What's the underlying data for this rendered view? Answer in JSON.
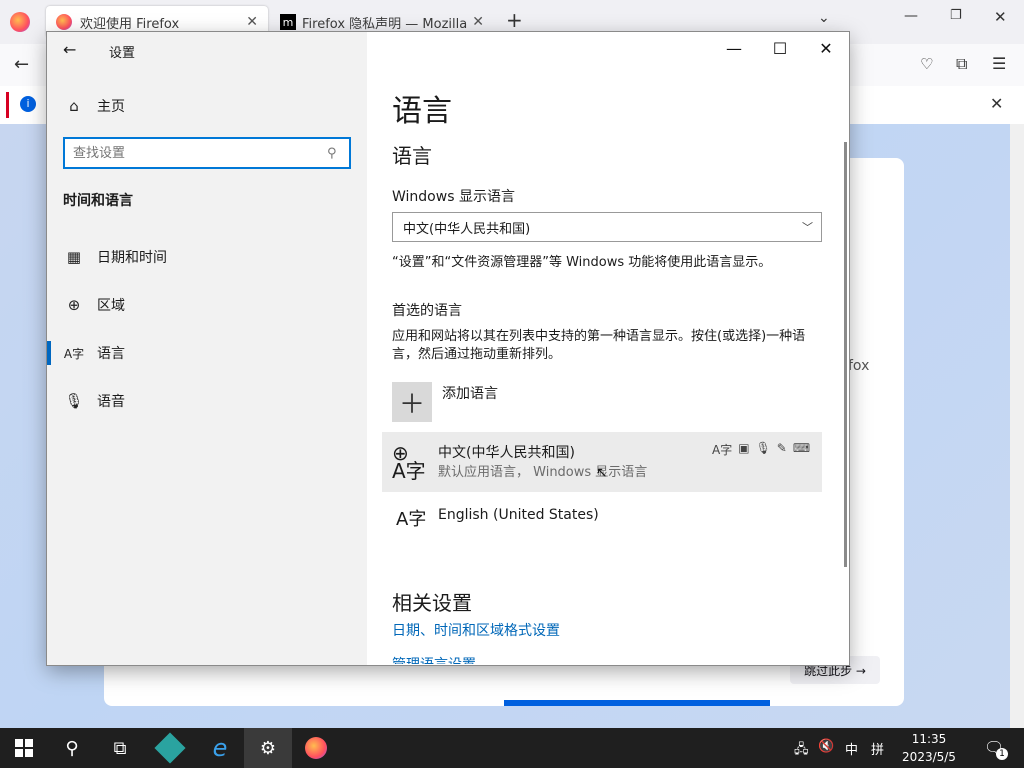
{
  "browser": {
    "tabs": [
      {
        "title": "欢迎使用 Firefox",
        "active": true
      },
      {
        "title": "Firefox 隐私声明 — Mozilla",
        "active": false
      }
    ],
    "new_tab": "+",
    "side_text": "fox",
    "skip_button": "跳过此步 →"
  },
  "settings": {
    "window_title": "设置",
    "nav": {
      "home": "主页",
      "search_placeholder": "查找设置",
      "section": "时间和语言",
      "items": [
        {
          "label": "日期和时间",
          "icon": "clock-calendar-icon"
        },
        {
          "label": "区域",
          "icon": "globe-icon"
        },
        {
          "label": "语言",
          "icon": "language-icon"
        },
        {
          "label": "语音",
          "icon": "microphone-icon"
        }
      ]
    },
    "main": {
      "page_title": "语言",
      "section_title": "语言",
      "display_language_label": "Windows 显示语言",
      "display_language_value": "中文(中华人民共和国)",
      "display_language_desc": "“设置”和“文件资源管理器”等 Windows 功能将使用此语言显示。",
      "preferred_title": "首选的语言",
      "preferred_desc": "应用和网站将以其在列表中支持的第一种语言显示。按住(或选择)一种语言，然后通过拖动重新排列。",
      "add_language": "添加语言",
      "languages": [
        {
          "name": "中文(中华人民共和国)",
          "sub": "默认应用语言， Windows 显示语言"
        },
        {
          "name": "English (United States)",
          "sub": ""
        }
      ],
      "related_title": "相关设置",
      "related_links": [
        "日期、时间和区域格式设置",
        "管理语言设置"
      ]
    }
  },
  "taskbar": {
    "ime": "中",
    "time": "11:35",
    "date": "2023/5/5",
    "notification_count": "1"
  }
}
